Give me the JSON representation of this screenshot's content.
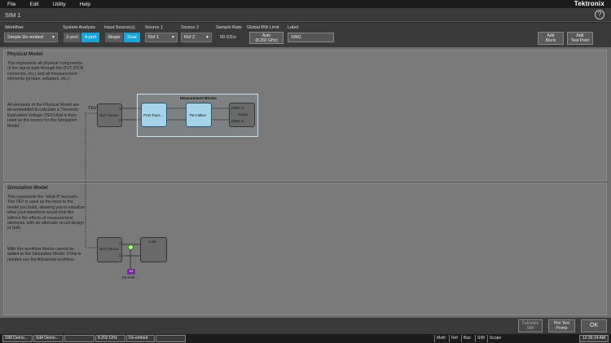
{
  "menu": [
    "File",
    "Edit",
    "Utility",
    "Help"
  ],
  "brand": "Tektronix",
  "window_title": "SIM 1",
  "toolbar": {
    "workflow": {
      "label": "Workflow",
      "value": "Simple De-embed"
    },
    "system_analysis": {
      "label": "System Analysis",
      "options": [
        "2-port",
        "4-port"
      ],
      "selected": "4-port"
    },
    "input_sources": {
      "label": "Input Source(s)",
      "options": [
        "Single",
        "Dual"
      ],
      "selected": "Dual"
    },
    "source1": {
      "label": "Source 1",
      "value": "Ref 1"
    },
    "source2": {
      "label": "Source 2",
      "value": "Ref 2"
    },
    "sample_rate": {
      "label": "Sample Rate",
      "value": "50 GS/s"
    },
    "global_bw": {
      "label": "Global BW Limit",
      "line1": "Auto",
      "line2": "(8.202 GHz)"
    },
    "label_field": {
      "label": "Label",
      "value": "SIM1"
    },
    "add_block": {
      "line1": "Add",
      "line2": "Block"
    },
    "add_test_point": {
      "line1": "Add",
      "line2": "Test Point"
    }
  },
  "physical": {
    "title": "Physical Model",
    "desc1": "This represents all physical components of the signal path through the DUT (PCB, connector, etc.) and all measurement elements (probes, adapters, etc.).",
    "desc2": "All elements of the Physical Model are de-embedded to calculate a Thevenin Equivalent Voltage (TEV) that is then used as the source for the Simulation Model."
  },
  "simulation": {
    "title": "Simulation Model",
    "desc1": "This represents the \"what-if\" scenario. The TEV is used as the input to the model you build, allowing you to visualize what your waveform would look like without the effects of measurement elements, with an alternate circuit design or both.",
    "desc2": "With this workflow blocks cannot be added to the Simulation Model. If this is needed use the Advanced workflow."
  },
  "diagram": {
    "tev_label": "TEV",
    "dut_source": "DUT Source",
    "measurement_blocks": "Measurement Blocks",
    "pcb_block": "PCB Trace...",
    "tm_block": "TM Cables",
    "scope_lines": [
      "(1Ref 1)",
      "Scope",
      "(2Ref 2)"
    ],
    "port_1": "1",
    "port_2": "2",
    "sim_dut_source": "DUT Source",
    "load": "Load",
    "tag_label": "H4",
    "deembed_label": "De-emb..."
  },
  "buttons": {
    "calculate": {
      "line1": "Calculate",
      "line2": "SIM"
    },
    "plot_test_points": {
      "line1": "Plot Test",
      "line2": "Points"
    },
    "ok": "OK"
  },
  "status": {
    "cells": [
      "SIM Demo...",
      "SIM Demo...",
      "",
      "8.202 GHz",
      "De-embed",
      ""
    ],
    "tabs": [
      "Math",
      "Ref",
      "Bus",
      "SIM",
      "Scope"
    ],
    "time": "12:36:14 AM"
  }
}
